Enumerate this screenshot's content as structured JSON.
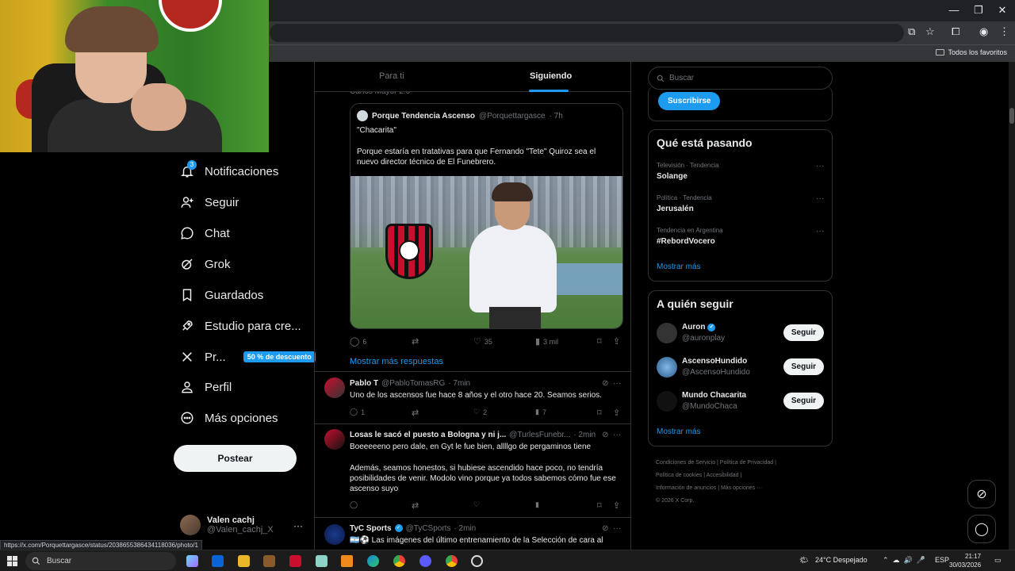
{
  "browser": {
    "bookmarks_all": "Todos los favoritos",
    "status_url": "https://x.com/Porquettargasce/status/2038655386434118036/photo/1"
  },
  "nav": {
    "items": [
      {
        "label": "Notificaciones",
        "icon": "bell-icon",
        "badge": "3"
      },
      {
        "label": "Seguir",
        "icon": "person-add-icon"
      },
      {
        "label": "Chat",
        "icon": "chat-icon"
      },
      {
        "label": "Grok",
        "icon": "grok-icon"
      },
      {
        "label": "Guardados",
        "icon": "bookmark-icon"
      },
      {
        "label": "Estudio para cre...",
        "icon": "rocket-icon"
      },
      {
        "label": "Pr...",
        "icon": "x-logo-icon",
        "promo": "50 % de descuento"
      },
      {
        "label": "Perfil",
        "icon": "person-icon"
      },
      {
        "label": "Más opciones",
        "icon": "more-circle-icon"
      }
    ],
    "post_button": "Postear",
    "account": {
      "name": "Valen cachj",
      "handle": "@Valen_cachj_X",
      "more": "···"
    }
  },
  "feed": {
    "tabs": [
      {
        "label": "Para ti"
      },
      {
        "label": "Siguiendo"
      }
    ],
    "faded_text": "Carlos Mayor 2:0",
    "quote": {
      "name": "Porque Tendencia Ascenso",
      "handle": "@Porquettargasce",
      "time": "· 7h",
      "text1": "\"Chacarita\"",
      "text2": "Porque estaría en tratativas para que Fernando \"Tete\" Quiroz sea el nuevo director técnico de El Funebrero."
    },
    "main_actions": {
      "replies": "6",
      "reposts": "",
      "likes": "35",
      "views": "3 mil"
    },
    "more_replies": "Mostrar más respuestas",
    "replies": [
      {
        "name": "Pablo T",
        "handle": "@PabloTomasRG",
        "time": "· 7min",
        "text": "Uno de los ascensos fue hace 8 años y el otro hace 20. Seamos serios.",
        "replies": "1",
        "likes": "2",
        "views": "7"
      },
      {
        "name": "Losas le sacó el puesto a Bologna y ni j...",
        "handle": "@TurlesFunebr...",
        "time": "· 2min",
        "text1": "Boeeeeeno pero dale, en Gyt le fue bien, allllgo de pergaminos tiene",
        "text2": "Además, seamos honestos, si hubiese ascendido hace poco, no tendría posibilidades de venir. Modolo vino porque ya todos sabemos cómo fue ese ascenso suyo"
      },
      {
        "name": "TyC Sports",
        "handle": "@TyCSports",
        "time": "· 2min",
        "text": "🇦🇷⚽ Las imágenes del último entrenamiento de la Selección de cara al"
      }
    ]
  },
  "sidebar": {
    "search_placeholder": "Buscar",
    "subscribe": "Suscribirse",
    "trends_title": "Qué está pasando",
    "trends": [
      {
        "meta": "Televisión · Tendencia",
        "name": "Solange"
      },
      {
        "meta": "Política · Tendencia",
        "name": "Jerusalén"
      },
      {
        "meta": "Tendencia en Argentina",
        "name": "#RebordVocero"
      }
    ],
    "show_more": "Mostrar más",
    "who_title": "A quién seguir",
    "who": [
      {
        "name": "Auron",
        "handle": "@auronplay",
        "verified": true,
        "button": "Seguir"
      },
      {
        "name": "AscensoHundido",
        "handle": "@AscensoHundido",
        "verified": false,
        "button": "Seguir"
      },
      {
        "name": "Mundo Chacarita",
        "handle": "@MundoChaca",
        "verified": false,
        "button": "Seguir"
      }
    ],
    "footer": {
      "line1": "Condiciones de Servicio  |  Política de Privacidad  |",
      "line2": "Política de cookies  |  Accesibilidad  |",
      "line3": "Información de anuncios  |  Más opciones ···",
      "line4": "© 2026 X Corp."
    }
  },
  "taskbar": {
    "search": "Buscar",
    "weather": "24°C  Despejado",
    "lang": "ESP",
    "time": "21:17",
    "date": "30/03/2026"
  },
  "colors": {
    "accent": "#1d9bf0",
    "bg": "#000000",
    "border": "#2f3336"
  }
}
